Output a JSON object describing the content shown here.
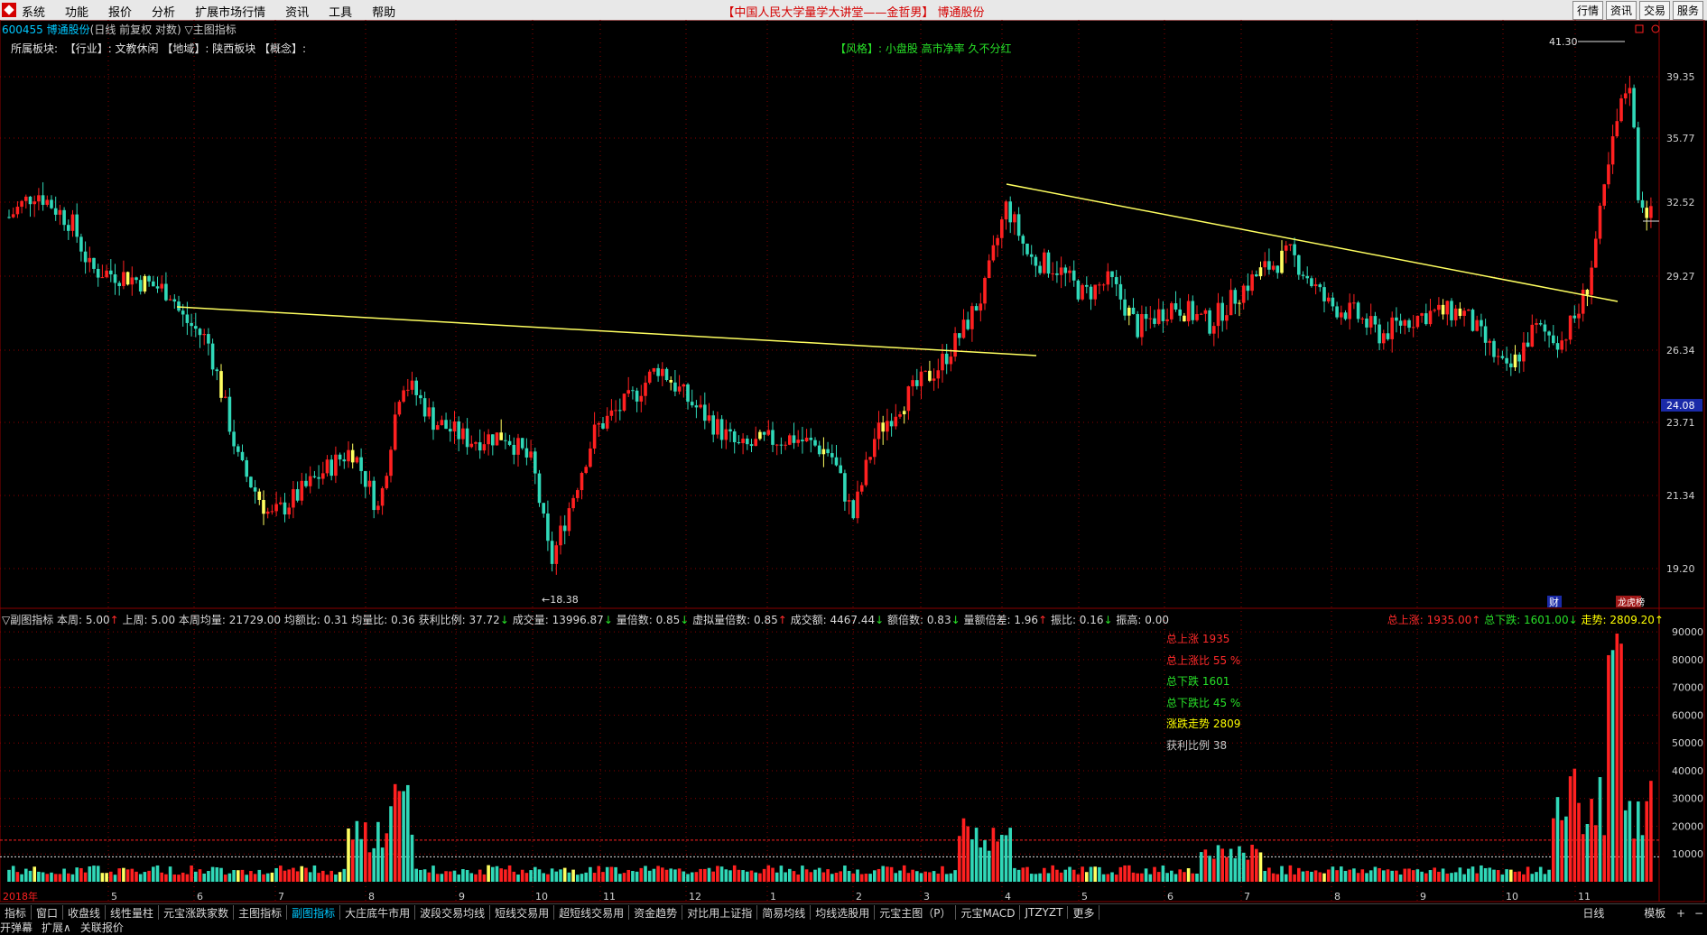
{
  "menu": {
    "items": [
      "系统",
      "功能",
      "报价",
      "分析",
      "扩展市场行情",
      "资讯",
      "工具",
      "帮助"
    ],
    "center_title": "【中国人民大学量学大讲堂——金哲男】 博通股份",
    "right_buttons": [
      "行情",
      "资讯",
      "交易",
      "服务"
    ]
  },
  "stock": {
    "code": "600455",
    "name": "博通股份",
    "mode": "(日线 前复权 对数)",
    "indicator": "▽主图指标"
  },
  "sector": {
    "label": "所属板块:",
    "text": "【行业】: 文教休闲 【地域】: 陕西板块 【概念】:"
  },
  "style_tag": "【风格】: 小盘股 高市净率 久不分红",
  "price_axis": {
    "labels": [
      "39.35",
      "35.77",
      "32.52",
      "29.27",
      "26.34",
      "23.71",
      "21.34",
      "19.20"
    ],
    "current": "24.08",
    "high_label": "41.30",
    "low_label": "←18.38"
  },
  "markers": {
    "cai": "财",
    "longhu": "龙虎榜"
  },
  "time_axis": {
    "year": "2018年",
    "months": [
      "5",
      "6",
      "7",
      "8",
      "9",
      "10",
      "11",
      "12",
      "1",
      "2",
      "3",
      "4",
      "5",
      "6",
      "7",
      "8",
      "9",
      "10",
      "11"
    ]
  },
  "sub_header": {
    "items": [
      {
        "t": "▽副图指标 本周: 5.00",
        "c": "up",
        "a": "↑"
      },
      {
        "t": " 上周: 5.00 本周均量: 21729.00 均额比: 0.31 均量比: 0.36 获利比例: 37.72",
        "c": "dn",
        "a": "↓"
      },
      {
        "t": " 成交量: 13996.87",
        "c": "dn",
        "a": "↓"
      },
      {
        "t": " 量倍数: 0.85",
        "c": "dn",
        "a": "↓"
      },
      {
        "t": " 虚拟量倍数: 0.85",
        "c": "up",
        "a": "↑"
      },
      {
        "t": " 成交额: 4467.44",
        "c": "dn",
        "a": "↓"
      },
      {
        "t": " 额倍数: 0.83",
        "c": "dn",
        "a": "↓"
      },
      {
        "t": " 量额倍差: 1.96",
        "c": "up",
        "a": "↑"
      },
      {
        "t": " 振比: 0.16",
        "c": "dn",
        "a": "↓"
      },
      {
        "t": " 振高: 0.00",
        "c": "",
        "a": ""
      }
    ],
    "right": [
      {
        "t": "总上涨: 1935.00",
        "c": "#ff2a2a",
        "a": "↑"
      },
      {
        "t": " 总下跌: 1601.00",
        "c": "#28e028",
        "a": "↓"
      },
      {
        "t": " 走势: 2809.20",
        "c": "#ffff00",
        "a": "↑"
      }
    ]
  },
  "legend": [
    {
      "t": "总上涨 1935",
      "c": "#ff2a2a"
    },
    {
      "t": "总上涨比 55 %",
      "c": "#ff2a2a"
    },
    {
      "t": "总下跌 1601",
      "c": "#28e028"
    },
    {
      "t": "总下跌比 45 %",
      "c": "#28e028"
    },
    {
      "t": "涨跌走势 2809",
      "c": "#ffff00"
    },
    {
      "t": "获利比例 38",
      "c": "#c8c8c8"
    }
  ],
  "vol_axis": [
    "90000",
    "80000",
    "70000",
    "60000",
    "50000",
    "40000",
    "30000",
    "20000",
    "10000"
  ],
  "tabs": [
    "指标",
    "窗口",
    "收盘线",
    "线性量柱",
    "元宝涨跌家数",
    "主图指标",
    "副图指标",
    "大庄底牛市用",
    "波段交易均线",
    "短线交易用",
    "超短线交易用",
    "资金趋势",
    "对比用上证指",
    "简易均线",
    "均线选股用",
    "元宝主图（P）",
    "元宝MACD",
    "JTZYZT",
    "更多"
  ],
  "active_tab": "副图指标",
  "tab_right": [
    "日线",
    "模板"
  ],
  "status": [
    "开弹幕",
    "扩展∧",
    "关联报价"
  ],
  "colors": {
    "up": "#ff2020",
    "down": "#30d8b8",
    "trend": "#ffff60",
    "grid": "#8a0000",
    "ma": "#e0e0e0"
  }
}
